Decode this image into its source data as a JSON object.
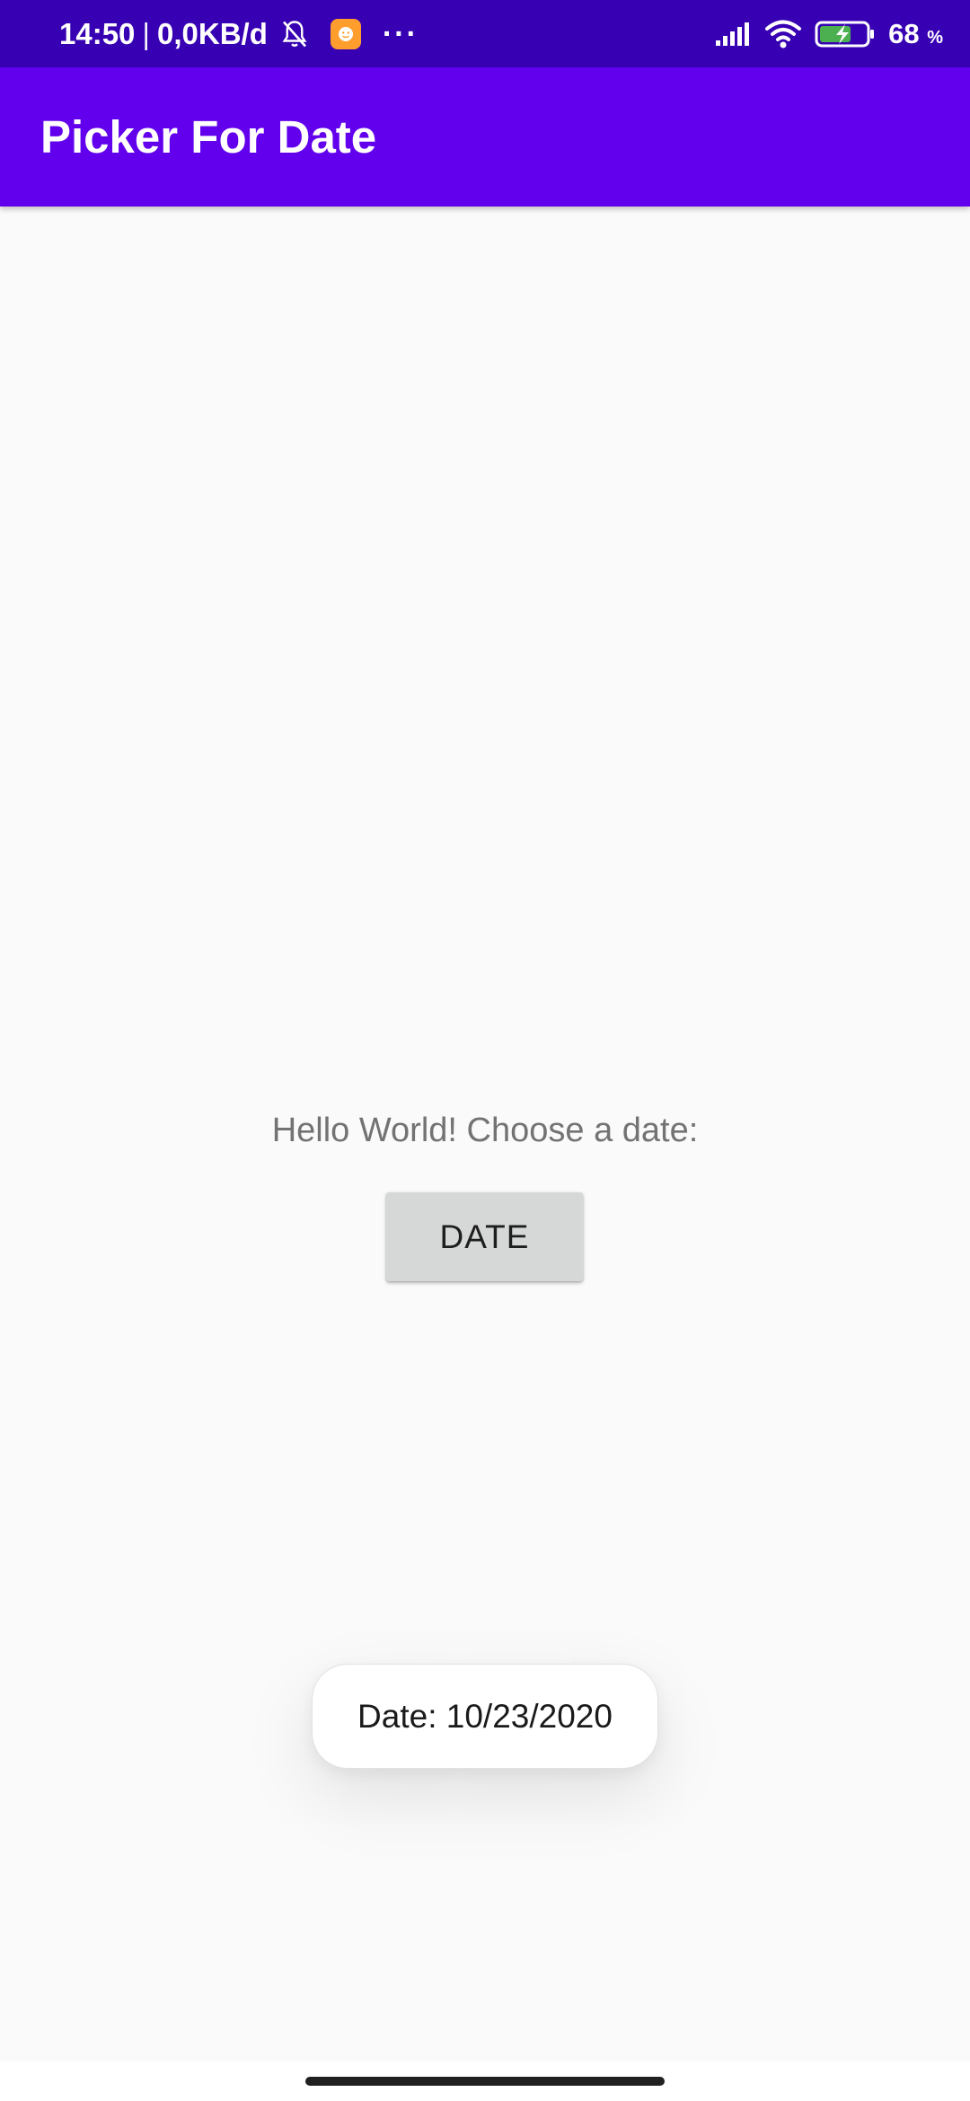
{
  "status_bar": {
    "time": "14:50",
    "separator": "|",
    "data_rate": "0,0KB/d",
    "more": "···",
    "battery_percent": "68",
    "battery_unit": "%",
    "icons": [
      "bell-off-icon",
      "app-notification-icon",
      "signal-icon",
      "wifi-icon",
      "battery-charging-icon"
    ]
  },
  "app_bar": {
    "title": "Picker For Date"
  },
  "main": {
    "prompt": "Hello World! Choose a date:",
    "date_button_label": "DATE"
  },
  "toast": {
    "message": "Date: 10/23/2020"
  },
  "colors": {
    "status_bar": "#3700b3",
    "app_bar": "#6200ee",
    "background": "#fafafa",
    "button": "#d6d7d7",
    "prompt_text": "#737373"
  }
}
